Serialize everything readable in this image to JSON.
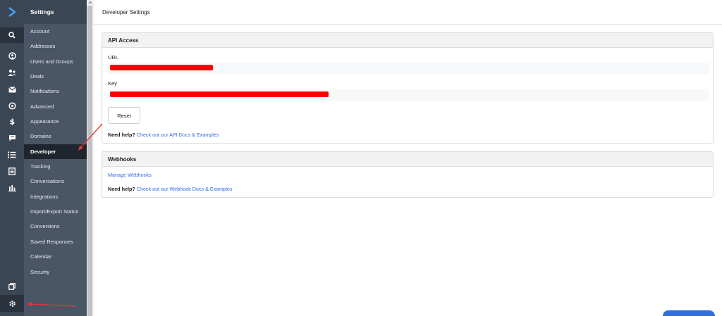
{
  "rail": {
    "icons": [
      {
        "name": "search-icon"
      },
      {
        "name": "contacts-icon"
      },
      {
        "name": "users-icon"
      },
      {
        "name": "mail-icon"
      },
      {
        "name": "automation-icon"
      },
      {
        "name": "dollar-icon"
      },
      {
        "name": "chat-icon"
      },
      {
        "name": "list-icon"
      },
      {
        "name": "document-icon"
      },
      {
        "name": "reports-icon"
      }
    ],
    "bottom": [
      "apps-icon",
      "settings-icon"
    ]
  },
  "nav": {
    "title": "Settings",
    "items": [
      "Account",
      "Addresses",
      "Users and Groups",
      "Deals",
      "Notifications",
      "Advanced",
      "Appearance",
      "Domains",
      "Developer",
      "Tracking",
      "Conversations",
      "Integrations",
      "Import/Export Status",
      "Conversions",
      "Saved Responses",
      "Calendar",
      "Security"
    ],
    "active": "Developer"
  },
  "page": {
    "title": "Developer Settings"
  },
  "api": {
    "title": "API Access",
    "url_label": "URL",
    "key_label": "Key",
    "reset_label": "Reset",
    "help_prefix": "Need help?",
    "help_link": "Check out our API Docs & Examples"
  },
  "webhooks": {
    "title": "Webhooks",
    "manage_link": "Manage Webhooks",
    "help_prefix": "Need help?",
    "help_link": "Check out our Webhook Docs & Examples"
  },
  "colors": {
    "rail": "#3b4654",
    "nav": "#4a5566",
    "nav_active": "#1f252e",
    "link": "#356ae6",
    "redaction": "#ff0000",
    "annotation": "#e53935"
  }
}
